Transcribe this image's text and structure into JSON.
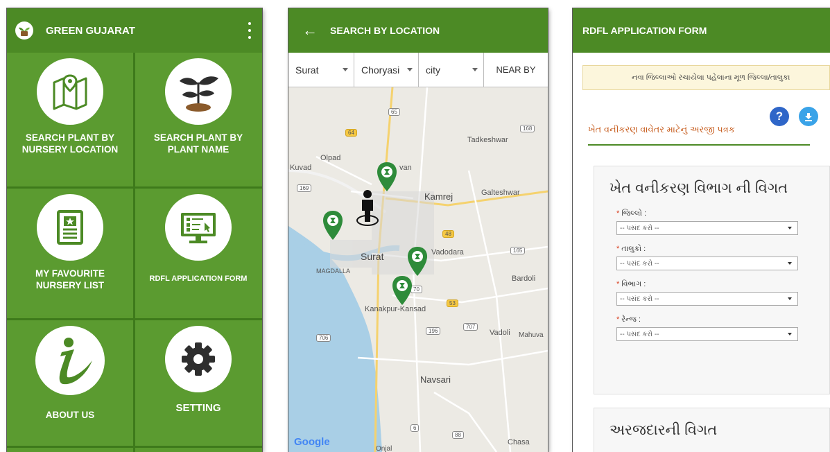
{
  "screen1": {
    "title": "GREEN GUJARAT",
    "tiles": [
      {
        "label": "SEARCH PLANT BY\nNURSERY LOCATION",
        "icon": "map-icon"
      },
      {
        "label": "SEARCH PLANT BY\nPLANT NAME",
        "icon": "sapling-icon"
      },
      {
        "label": "MY FAVOURITE\nNURSERY LIST",
        "icon": "favourite-list-icon"
      },
      {
        "label": "RDFL APPLICATION FORM",
        "icon": "form-monitor-icon"
      },
      {
        "label": "ABOUT US",
        "icon": "info-icon"
      },
      {
        "label": "SETTING",
        "icon": "gear-icon"
      }
    ]
  },
  "screen2": {
    "title": "SEARCH BY LOCATION",
    "filters": {
      "district": "Surat",
      "taluka": "Choryasi",
      "area": "city",
      "nearby": "NEAR BY"
    },
    "map_labels": {
      "tadkeshwar": "Tadkeshwar",
      "olpad": "Olpad",
      "kuvad": "Kuvad",
      "kamrej": "Kamrej",
      "galteshwar": "Galteshwar",
      "surat": "Surat",
      "magdalla": "MAGDALLA",
      "vadodara": "Vadodara",
      "bardoli": "Bardoli",
      "kanakpur": "Kanakpur-Kansad",
      "vadoli": "Vadoli",
      "mahuva": "Mahuva",
      "navsari": "Navsari",
      "chasa": "Chasa",
      "onjal": "Onjal",
      "van": "van"
    },
    "shields": [
      "65",
      "168",
      "64",
      "169",
      "48",
      "165",
      "70",
      "53",
      "196",
      "707",
      "706",
      "6",
      "88"
    ],
    "map_brand": "Google"
  },
  "screen3": {
    "title": "RDFL APPLICATION FORM",
    "marquee": "નવા જિલ્લાઓ રચાયેલા પહેલાના મૂળ જિલ્લા/તાલુકા",
    "form_title": "ખેત વનીકરણ વાવેતર માટેનું અરજી પત્રક",
    "section1": {
      "heading": "ખેત વનીકરણ વિભાગ ની વિગત",
      "fields": [
        {
          "label": "જિલ્લો :",
          "placeholder": "-- પસંદ કરો --"
        },
        {
          "label": "તાલુકો :",
          "placeholder": "-- પસંદ કરો --"
        },
        {
          "label": "વિભાગ :",
          "placeholder": "-- પસંદ કરો --"
        },
        {
          "label": "રેન્જ :",
          "placeholder": "-- પસંદ કરો --"
        }
      ]
    },
    "section2": {
      "heading": "અરજદારની વિગત"
    }
  }
}
